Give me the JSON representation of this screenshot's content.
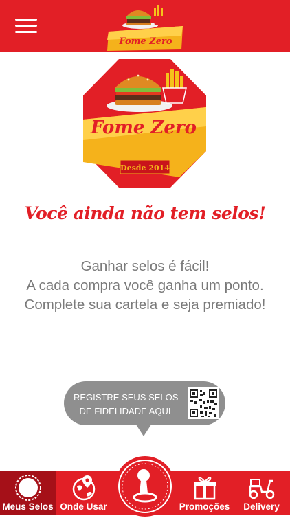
{
  "header": {
    "menu_icon": "hamburger-menu-icon",
    "logo_text": "Fome Zero"
  },
  "brand": {
    "logo_text": "Fome Zero",
    "since_label": "Desde 2014",
    "colors": {
      "primary": "#e21f26",
      "accent": "#f5b21b",
      "dark_red": "#a51018"
    }
  },
  "main": {
    "title": "Você ainda não tem selos!",
    "info_lines": [
      "Ganhar selos é fácil!",
      "A cada compra você ganha um ponto.",
      "Complete sua cartela e seja premiado!"
    ]
  },
  "register": {
    "line1": "REGISTRE SEUS SELOS",
    "line2": "DE FIDELIDADE AQUI",
    "icon": "qr-code-icon"
  },
  "tabs": [
    {
      "label": "Meus Selos",
      "icon": "seal-icon",
      "active": true
    },
    {
      "label": "Onde Usar",
      "icon": "map-pin-globe-icon",
      "active": false
    },
    {
      "label": "",
      "icon": "stamp-icon",
      "active": false
    },
    {
      "label": "Promoções",
      "icon": "gift-icon",
      "active": false
    },
    {
      "label": "Delivery",
      "icon": "scooter-icon",
      "active": false
    }
  ]
}
